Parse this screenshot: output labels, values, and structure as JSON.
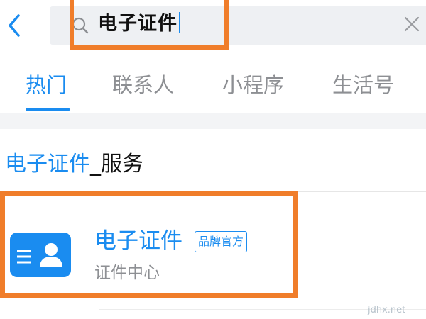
{
  "search": {
    "query": "电子证件"
  },
  "tabs": [
    {
      "label": "热门",
      "active": true
    },
    {
      "label": "联系人",
      "active": false
    },
    {
      "label": "小程序",
      "active": false
    },
    {
      "label": "生活号",
      "active": false
    }
  ],
  "section": {
    "keyword": "电子证件",
    "suffix": "_服务"
  },
  "result": {
    "title": "电子证件",
    "badge": "品牌官方",
    "subtitle": "证件中心",
    "icon": "id-card-icon"
  },
  "watermark": "jdhx.net",
  "colors": {
    "accent": "#1a8cf0",
    "highlight": "#f07d2a",
    "muted_text": "#8d8f93",
    "search_bg": "#eef0f3"
  }
}
